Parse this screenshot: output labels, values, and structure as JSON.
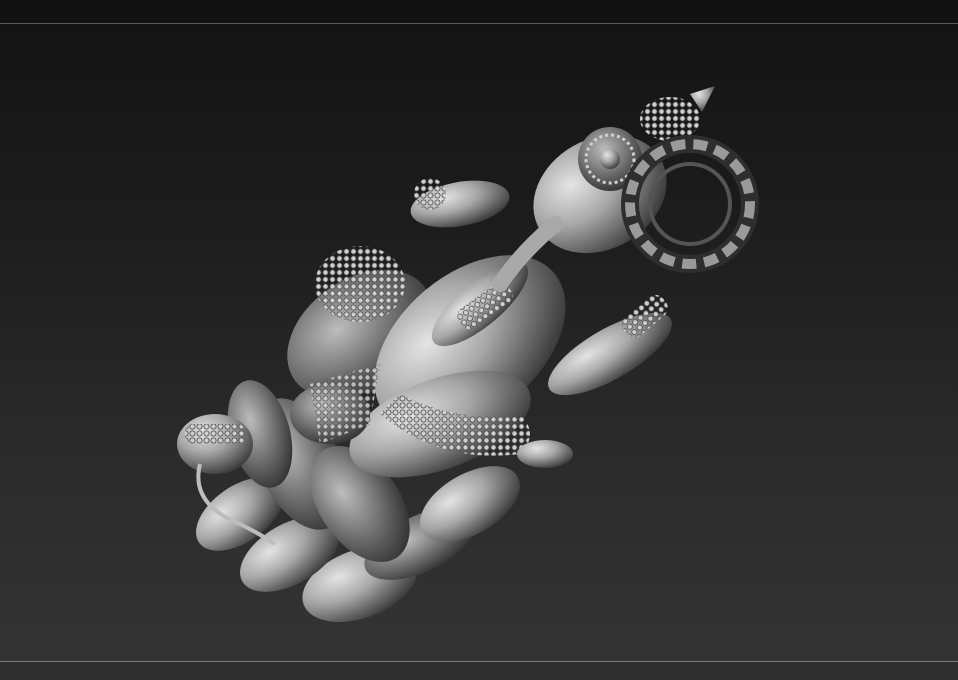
{
  "app": {
    "canvas_background": "#1c1c1c",
    "material_color": "#b5b5b5"
  },
  "viewport": {
    "subject_icon": "sculpt-model-icon"
  }
}
